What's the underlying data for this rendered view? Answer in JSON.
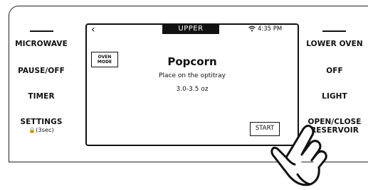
{
  "left_buttons": [
    {
      "label": "MICROWAVE"
    },
    {
      "label": "PAUSE/OFF"
    },
    {
      "label": "TIMER"
    },
    {
      "label": "SETTINGS",
      "sub": "🔒(3sec)"
    }
  ],
  "right_buttons": [
    {
      "label": "LOWER OVEN"
    },
    {
      "label": "OFF"
    },
    {
      "label": "LIGHT"
    },
    {
      "label": "OPEN/CLOSE RESERVOIR"
    }
  ],
  "screen": {
    "back_icon": "‹",
    "tab_label": "UPPER",
    "time": "4:35 PM",
    "oven_mode_label": "OVEN MODE",
    "title": "Popcorn",
    "instruction": "Place on the optitray",
    "amount": "3.0-3.5 oz",
    "start_label": "START"
  },
  "icons": [
    "back-icon",
    "wifi-icon",
    "lock-icon",
    "hand-pointer-icon"
  ]
}
